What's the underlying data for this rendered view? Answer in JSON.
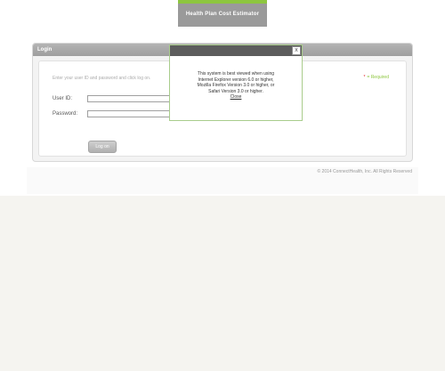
{
  "header": {
    "logo_text": "Health Plan Cost Estimator"
  },
  "login": {
    "title": "Login",
    "instructions": "Enter your user ID and password and click log on.",
    "required_star": "*",
    "required_text": "= Required",
    "user_id_label": "User ID:",
    "user_id_value": "",
    "password_label": "Password:",
    "password_value": "",
    "button_label": "Log on"
  },
  "footer": {
    "copyright": "© 2014 ConnectHealth, Inc. All Rights Reserved"
  },
  "popup": {
    "close_label": "x",
    "lines": [
      "This system is best viewed when using",
      "Internet Explorer version 6.0 or higher,",
      "Mozilla Firefox Version 3.0 or higher, or",
      "Safari Version 3.0 or higher."
    ],
    "link_text": "Close"
  },
  "colors": {
    "accent": "#8dc63f",
    "required_star": "#e21e26",
    "header_gray": "#9a9a9a",
    "popup_titlebar": "#5d5d5d"
  }
}
